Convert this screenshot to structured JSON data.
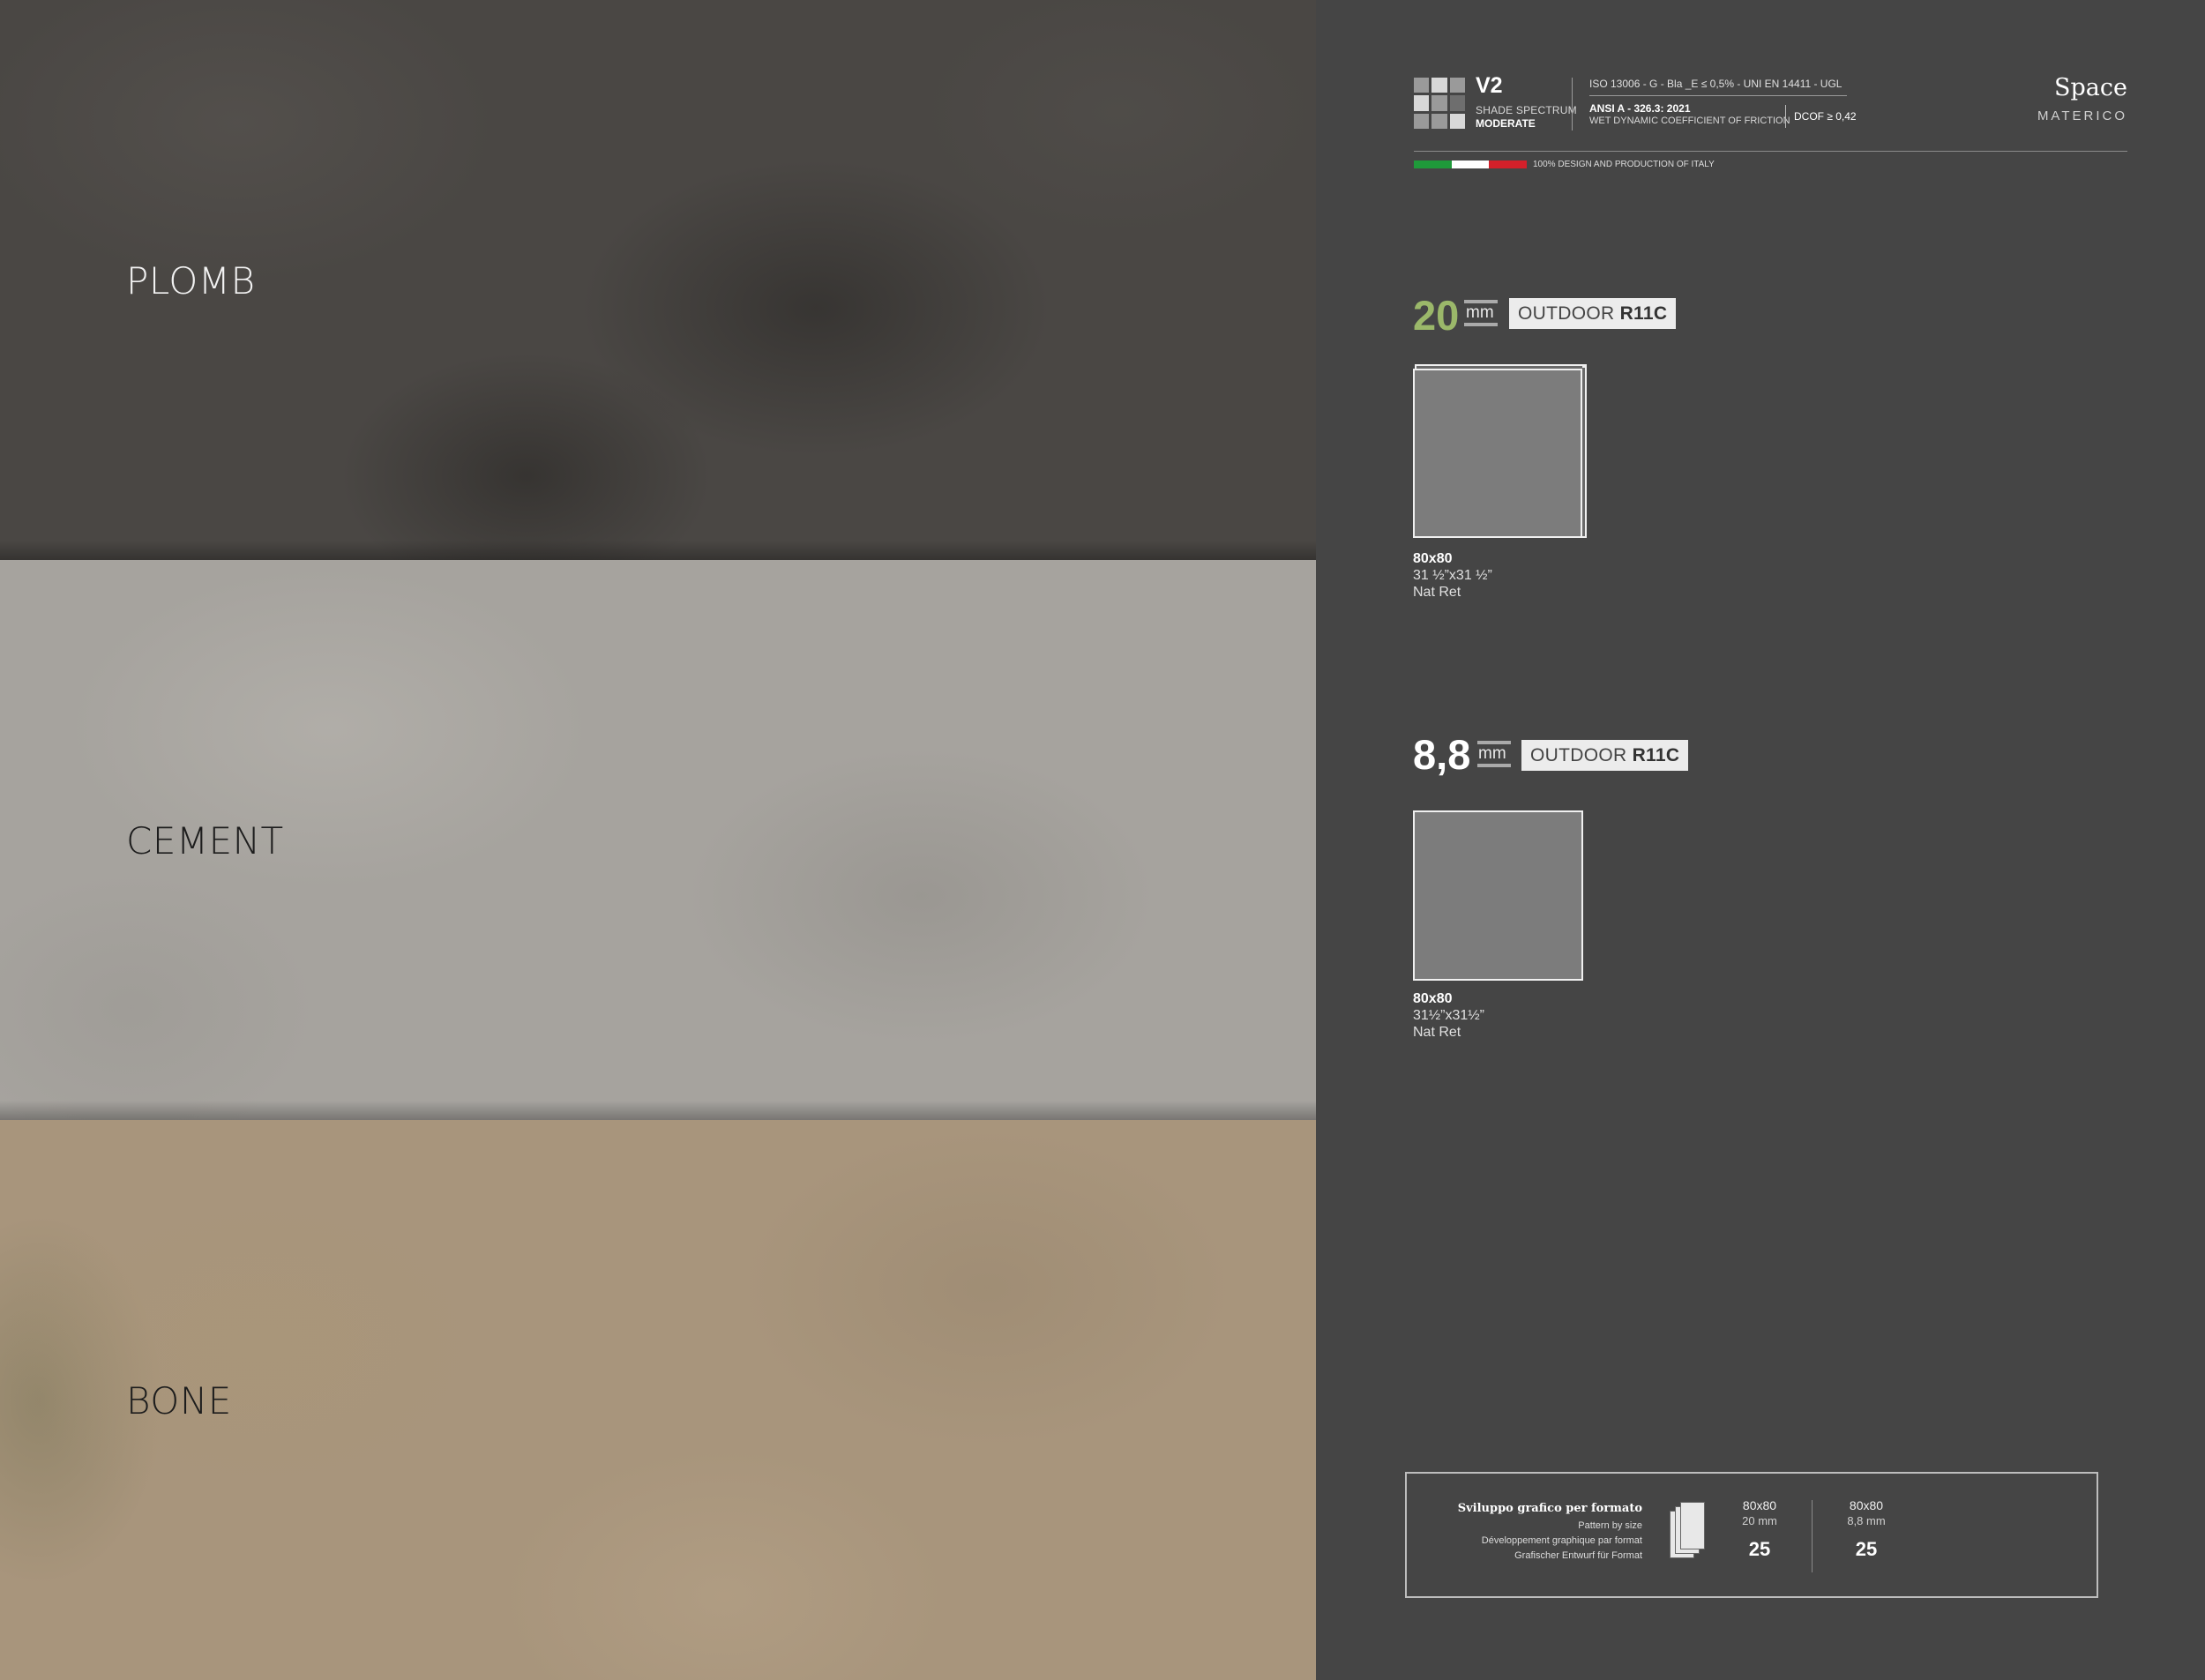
{
  "swatches": {
    "plomb": "PLOMB",
    "cement": "CEMENT",
    "bone": "BONE"
  },
  "header": {
    "shade_code": "V2",
    "shade_label": "SHADE SPECTRUM",
    "shade_value": "MODERATE",
    "iso": "ISO 13006 - G - Bla _E ≤ 0,5% - UNI EN 14411 - UGL",
    "ansi": "ANSI A - 326.3: 2021",
    "wet": "WET DYNAMIC COEFFICIENT OF FRICTION",
    "dcof": "DCOF ≥ 0,42",
    "brand": "Space",
    "brand_sub": "MATERICO",
    "made_in": "100% DESIGN AND PRODUCTION OF ITALY",
    "flag_colors": [
      "#1f9a3a",
      "#ffffff",
      "#d3202a"
    ]
  },
  "products": [
    {
      "thickness": "20",
      "unit": "mm",
      "outdoor": "OUTDOOR",
      "rating": "R11C",
      "format": "80x80",
      "imperial": "31 ½”x31 ½”",
      "finish": "Nat Ret"
    },
    {
      "thickness": "8,8",
      "unit": "mm",
      "outdoor": "OUTDOOR",
      "rating": "R11C",
      "format": "80x80",
      "imperial": "31½”x31½”",
      "finish": "Nat Ret"
    }
  ],
  "pattern": {
    "title": "Sviluppo grafico per formato",
    "lines": [
      "Pattern by size",
      "Développement graphique par format",
      "Grafischer Entwurf für Format"
    ],
    "columns": [
      {
        "format": "80x80",
        "thickness": "20 mm",
        "count": "25"
      },
      {
        "format": "80x80",
        "thickness": "8,8 mm",
        "count": "25"
      }
    ]
  },
  "colors": {
    "panel_bg": "#454545",
    "accent_green": "#9bb86a",
    "plomb": "#4a4744",
    "cement": "#a6a39e",
    "bone": "#a8957c"
  }
}
